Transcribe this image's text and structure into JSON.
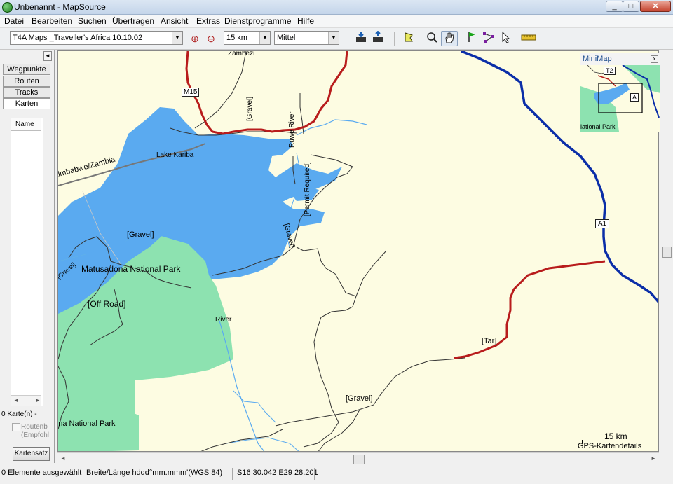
{
  "window": {
    "title": "Unbenannt - MapSource",
    "minimize": "_",
    "maximize": "□",
    "close": "✕"
  },
  "menu": [
    "Datei",
    "Bearbeiten",
    "Suchen",
    "Übertragen",
    "Ansicht",
    "Extras",
    "Dienstprogramme",
    "Hilfe"
  ],
  "toolbar": {
    "map_product": "T4A Maps _Traveller's Africa 10.10.02",
    "zoom_level": "15 km",
    "detail_level": "Mittel"
  },
  "left_panel": {
    "tabs": [
      "Wegpunkte",
      "Routen",
      "Tracks",
      "Karten"
    ],
    "active_tab": "Karten",
    "list_header": "Name",
    "map_count": "0 Karte(n) -",
    "checkbox_label_1": "Routenb",
    "checkbox_label_2": "(Empfohl",
    "button_label": "Kartensatz"
  },
  "map": {
    "labels": {
      "zambezi": "Zambezi",
      "m15": "M15",
      "lake_kariba": "Lake Kariba",
      "border": "Zimbabwe/Zambia",
      "gravel_1": "[Gravel]",
      "ruwe_river": "Ruwe River",
      "permit": "[Permit Required]",
      "gravel_2": "[Gravel]",
      "gravel_3": "[Gravel]",
      "matusadona": "Matusadona National Park",
      "gravel_4": "[Gravel]",
      "offroad": "[Off Road]",
      "river": "River",
      "gravel_5": "[Gravel]",
      "park_2": "dona National Park",
      "a1": "A1",
      "tar": "[Tar]",
      "gravel_6": "[Gravel]"
    },
    "colors": {
      "land": "#fdfce2",
      "water": "#5aaaf0",
      "park": "#8de2b0",
      "highway": "#0b2ea8",
      "main_road": "#b81c1c"
    }
  },
  "minimap": {
    "title": "MiniMap",
    "close": "x",
    "label_t2": "T2",
    "label_a": "A",
    "label_park": "lational Park"
  },
  "scale": {
    "distance": "15 km",
    "detail": "GPS-Kartendetails"
  },
  "status": {
    "selection": "0 Elemente ausgewählt",
    "format": "Breite/Länge hddd°mm.mmm'(WGS 84)",
    "coords": "S16 30.042 E29 28.201"
  }
}
